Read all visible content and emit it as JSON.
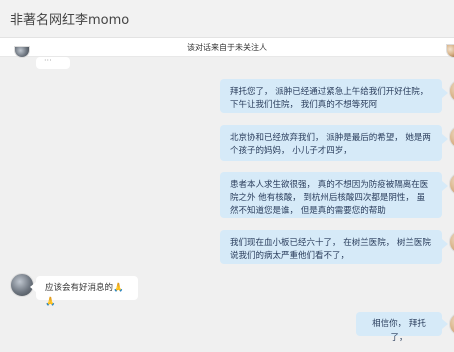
{
  "window": {
    "title": "非著名网红李momo"
  },
  "notice": {
    "text": "该对话来自于未关注人"
  },
  "messages": [
    {
      "side": "right",
      "text": "拜托您了，  派肿已经通过紧急上午给我们开好住院，  下午让我们住院，  我们真的不想等死阿"
    },
    {
      "side": "right",
      "text": "北京协和已经放弃我们，  派肿是最后的希望，  她是两个孩子的妈妈，  小儿子才四岁，"
    },
    {
      "side": "right",
      "text": "患者本人求生欲很强，  真的不想因为防疫被隔离在医院之外  他有核酸，  到杭州后核酸四次都是阴性，  虽然不知道您是谁，  但是真的需要您的帮助"
    },
    {
      "side": "right",
      "text": "我们现在血小板已经六十了，  在树兰医院，  树兰医院说我们的病太严重他们看不了，"
    },
    {
      "side": "left",
      "text": "应该会有好消息的",
      "emoji": "🙏🙏"
    },
    {
      "side": "right",
      "text": "相信你，  拜托了，"
    }
  ],
  "top_partial_bubble": {
    "text": "···"
  }
}
